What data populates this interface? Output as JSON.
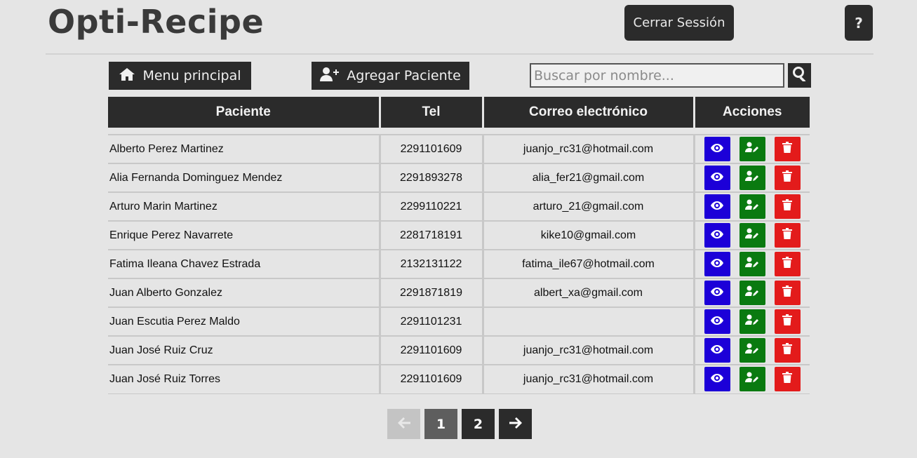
{
  "header": {
    "app_title": "Opti-Recipe",
    "logout_label": "Cerrar Sessión",
    "help_label": "?"
  },
  "toolbar": {
    "menu_label": "Menu principal",
    "menu_icon": "home-icon",
    "add_label": "Agregar Paciente",
    "add_icon": "user-plus-icon",
    "search_placeholder": "Buscar por nombre...",
    "search_icon": "search-icon"
  },
  "table": {
    "headers": [
      "Paciente",
      "Tel",
      "Correo electrónico",
      "Acciones"
    ],
    "rows": [
      {
        "name": "Alberto Perez Martinez",
        "tel": "2291101609",
        "email": "juanjo_rc31@hotmail.com"
      },
      {
        "name": "Alia Fernanda Dominguez Mendez",
        "tel": "2291893278",
        "email": "alia_fer21@gmail.com"
      },
      {
        "name": "Arturo Marin Martinez",
        "tel": "2299110221",
        "email": "arturo_21@gmail.com"
      },
      {
        "name": "Enrique Perez Navarrete",
        "tel": "2281718191",
        "email": "kike10@gmail.com"
      },
      {
        "name": "Fatima Ileana Chavez Estrada",
        "tel": "2132131122",
        "email": "fatima_ile67@hotmail.com"
      },
      {
        "name": "Juan Alberto Gonzalez",
        "tel": "2291871819",
        "email": "albert_xa@gmail.com"
      },
      {
        "name": "Juan Escutia Perez Maldo",
        "tel": "2291101231",
        "email": ""
      },
      {
        "name": "Juan José Ruiz Cruz",
        "tel": "2291101609",
        "email": "juanjo_rc31@hotmail.com"
      },
      {
        "name": "Juan José Ruiz Torres",
        "tel": "2291101609",
        "email": "juanjo_rc31@hotmail.com"
      }
    ],
    "action_icons": [
      "eye-icon",
      "user-edit-icon",
      "trash-icon"
    ],
    "action_colors": {
      "view": "#1c00d8",
      "edit": "#0a7a10",
      "delete": "#e31b1b"
    }
  },
  "pagination": {
    "prev_icon": "arrow-left-icon",
    "pages": [
      "1",
      "2"
    ],
    "current_page": "1",
    "next_icon": "arrow-right-icon"
  }
}
